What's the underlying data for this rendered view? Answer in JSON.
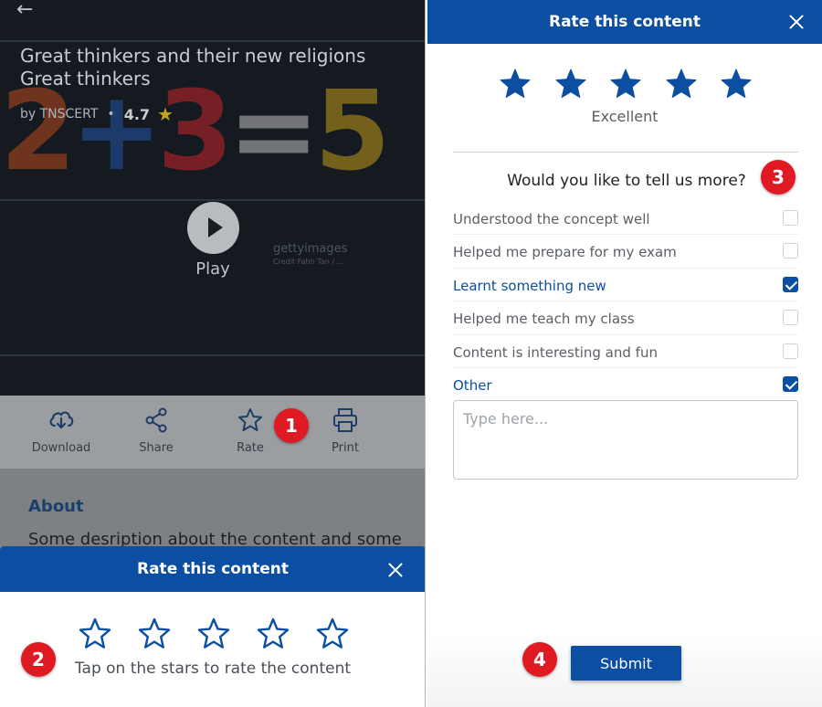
{
  "player": {
    "title_line1": "Great thinkers and their new religions",
    "title_line2": "Great thinkers",
    "author": "by TNSCERT",
    "rating": "4.7",
    "play_label": "Play",
    "watermark": "gettyimages",
    "watermark_sub": "Credit Fatih Tan / ...",
    "decor_digits": [
      "2",
      "+",
      "3",
      "=",
      "5"
    ]
  },
  "actions": [
    {
      "label": "Download",
      "icon": "cloud-download-icon"
    },
    {
      "label": "Share",
      "icon": "share-icon"
    },
    {
      "label": "Rate",
      "icon": "star-outline-icon"
    },
    {
      "label": "Print",
      "icon": "printer-icon"
    }
  ],
  "about": {
    "title": "About",
    "text": "Some desription about the content and some"
  },
  "rate_sheet": {
    "title": "Rate this content",
    "star_count": 5,
    "selected_stars": 0,
    "hint": "Tap on the stars to rate the content"
  },
  "rate_dialog": {
    "title": "Rate this content",
    "star_count": 5,
    "selected_stars": 5,
    "rating_label": "Excellent",
    "question": "Would you like to tell us more?",
    "options": [
      {
        "label": "Understood the concept well",
        "checked": false
      },
      {
        "label": "Helped me prepare for my exam",
        "checked": false
      },
      {
        "label": "Learnt something new",
        "checked": true
      },
      {
        "label": "Helped me teach my class",
        "checked": false
      },
      {
        "label": "Content is interesting and fun",
        "checked": false
      },
      {
        "label": "Other",
        "checked": true
      }
    ],
    "textarea_placeholder": "Type here...",
    "textarea_value": "",
    "submit_label": "Submit"
  },
  "badges": [
    "1",
    "2",
    "3",
    "4"
  ],
  "colors": {
    "brand_blue": "#0b4ea2",
    "badge_red": "#e01a23",
    "star_gold": "#c7a51a"
  }
}
